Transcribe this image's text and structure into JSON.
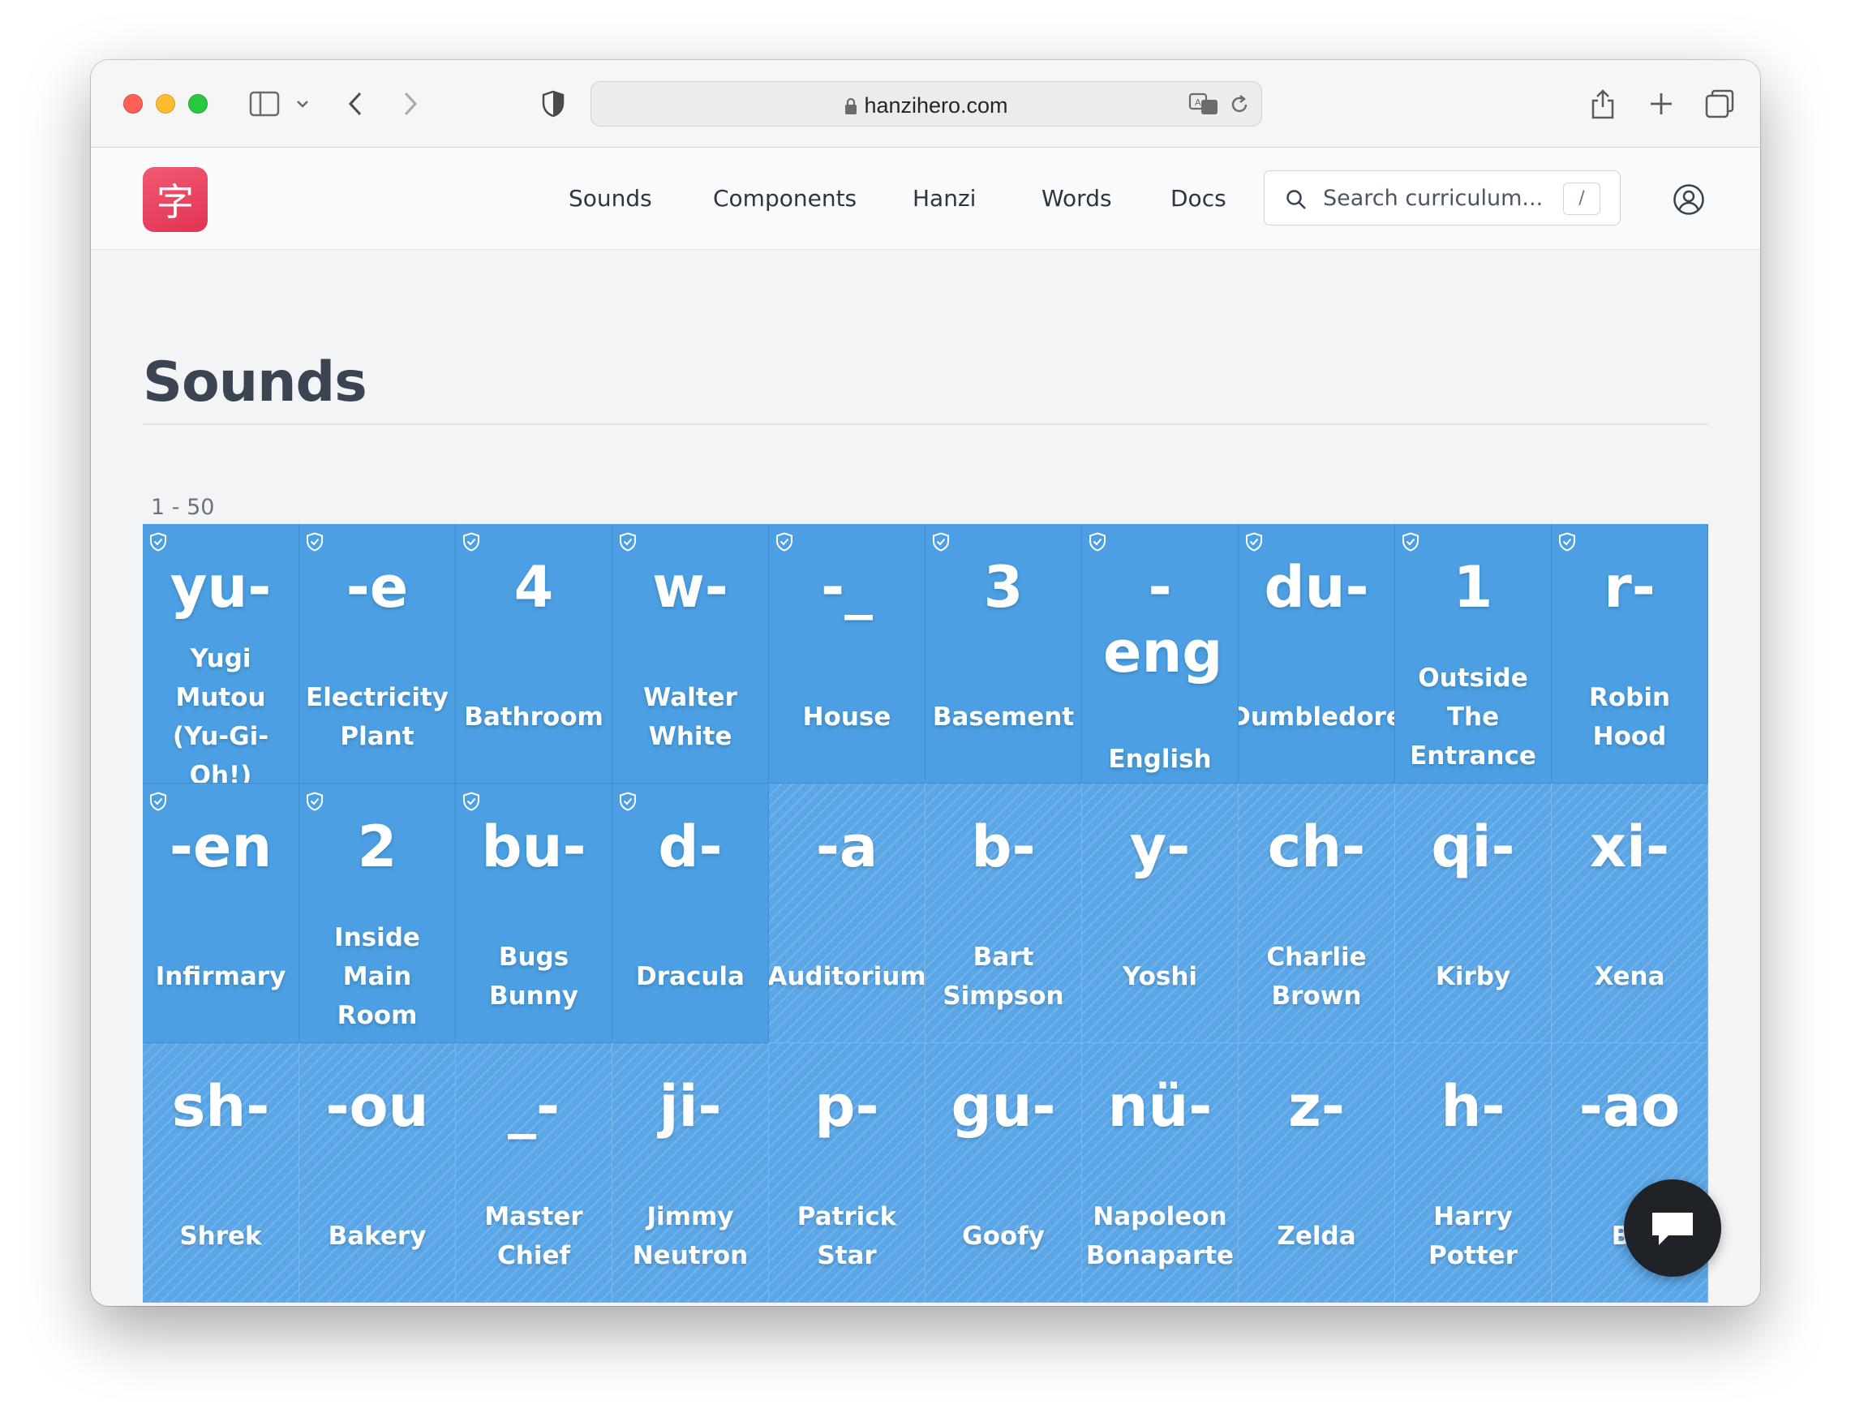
{
  "browser": {
    "url": "hanzihero.com"
  },
  "site": {
    "logo_glyph": "字",
    "nav": [
      "Sounds",
      "Components",
      "Hanzi",
      "Words",
      "Docs"
    ],
    "search_placeholder": "Search curriculum...",
    "search_shortcut": "/"
  },
  "page": {
    "title": "Sounds",
    "range": "1 - 50"
  },
  "cards": [
    {
      "sound": "yu-",
      "label": [
        "Yugi",
        "Mutou",
        "(Yu-Gi-",
        "Oh!)"
      ],
      "unlocked": true
    },
    {
      "sound": "-e",
      "label": [
        "Electricity",
        "Plant"
      ],
      "unlocked": true
    },
    {
      "sound": "4",
      "label": [
        "Bathroom"
      ],
      "unlocked": true
    },
    {
      "sound": "w-",
      "label": [
        "Walter",
        "White"
      ],
      "unlocked": true
    },
    {
      "sound": "-_",
      "label": [
        "House"
      ],
      "unlocked": true
    },
    {
      "sound": "3",
      "label": [
        "Basement"
      ],
      "unlocked": true
    },
    {
      "sound": "-eng",
      "label": [
        "English"
      ],
      "unlocked": true
    },
    {
      "sound": "du-",
      "label": [
        "Dumbledore"
      ],
      "unlocked": true
    },
    {
      "sound": "1",
      "label": [
        "Outside",
        "The",
        "Entrance"
      ],
      "unlocked": true
    },
    {
      "sound": "r-",
      "label": [
        "Robin",
        "Hood"
      ],
      "unlocked": true
    },
    {
      "sound": "-en",
      "label": [
        "Infirmary"
      ],
      "unlocked": true
    },
    {
      "sound": "2",
      "label": [
        "Inside",
        "Main",
        "Room"
      ],
      "unlocked": true
    },
    {
      "sound": "bu-",
      "label": [
        "Bugs",
        "Bunny"
      ],
      "unlocked": true
    },
    {
      "sound": "d-",
      "label": [
        "Dracula"
      ],
      "unlocked": true
    },
    {
      "sound": "-a",
      "label": [
        "Auditorium"
      ],
      "unlocked": false
    },
    {
      "sound": "b-",
      "label": [
        "Bart",
        "Simpson"
      ],
      "unlocked": false
    },
    {
      "sound": "y-",
      "label": [
        "Yoshi"
      ],
      "unlocked": false
    },
    {
      "sound": "ch-",
      "label": [
        "Charlie",
        "Brown"
      ],
      "unlocked": false
    },
    {
      "sound": "qi-",
      "label": [
        "Kirby"
      ],
      "unlocked": false
    },
    {
      "sound": "xi-",
      "label": [
        "Xena"
      ],
      "unlocked": false
    },
    {
      "sound": "sh-",
      "label": [
        "Shrek"
      ],
      "unlocked": false
    },
    {
      "sound": "-ou",
      "label": [
        "Bakery"
      ],
      "unlocked": false
    },
    {
      "sound": "_-",
      "label": [
        "Master",
        "Chief"
      ],
      "unlocked": false
    },
    {
      "sound": "ji-",
      "label": [
        "Jimmy",
        "Neutron"
      ],
      "unlocked": false
    },
    {
      "sound": "p-",
      "label": [
        "Patrick",
        "Star"
      ],
      "unlocked": false
    },
    {
      "sound": "gu-",
      "label": [
        "Goofy"
      ],
      "unlocked": false
    },
    {
      "sound": "nü-",
      "label": [
        "Napoleon",
        "Bonaparte"
      ],
      "unlocked": false
    },
    {
      "sound": "z-",
      "label": [
        "Zelda"
      ],
      "unlocked": false
    },
    {
      "sound": "h-",
      "label": [
        "Harry",
        "Potter"
      ],
      "unlocked": false
    },
    {
      "sound": "-ao",
      "label": [
        "Ba"
      ],
      "unlocked": false
    }
  ],
  "icons": {
    "badge": "shield-check-icon",
    "chat": "chat-bubble-icon"
  },
  "colors": {
    "card_unlocked": "#4b9fe2",
    "card_locked": "#5aa6e6",
    "logo": "#e23352"
  }
}
